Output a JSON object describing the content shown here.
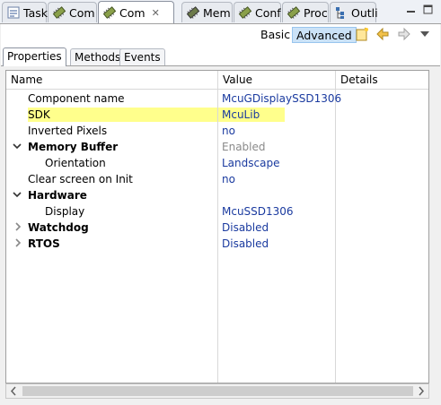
{
  "tabs": [
    {
      "label": "Task",
      "icon": "tasks-icon"
    },
    {
      "label": "Com",
      "icon": "component-icon"
    },
    {
      "label": "Com",
      "icon": "component-icon",
      "active": true
    },
    {
      "label": "Mem",
      "icon": "memory-icon"
    },
    {
      "label": "Conf",
      "icon": "config-icon"
    },
    {
      "label": "Proc",
      "icon": "processor-icon"
    },
    {
      "label": "Outli",
      "icon": "outline-icon"
    }
  ],
  "toolbar": {
    "basic": "Basic",
    "advanced": "Advanced"
  },
  "inner_tabs": [
    "Properties",
    "Methods",
    "Events"
  ],
  "columns": {
    "name": "Name",
    "value": "Value",
    "details": "Details"
  },
  "rows": [
    {
      "name": "Component name",
      "value": "McuGDisplaySSD1306"
    },
    {
      "name": "SDK",
      "value": "McuLib"
    },
    {
      "name": "Inverted Pixels",
      "value": "no"
    },
    {
      "name": "Memory Buffer",
      "value": "Enabled"
    },
    {
      "name": "Orientation",
      "value": "Landscape"
    },
    {
      "name": "Clear screen on Init",
      "value": "no"
    },
    {
      "name": "Hardware",
      "value": ""
    },
    {
      "name": "Display",
      "value": "McuSSD1306"
    },
    {
      "name": "Watchdog",
      "value": "Disabled"
    },
    {
      "name": "RTOS",
      "value": "Disabled"
    }
  ],
  "colors": {
    "highlight": "#ffff8c",
    "value_text": "#1a3a9f",
    "selected_button": "#cbe2f7"
  }
}
